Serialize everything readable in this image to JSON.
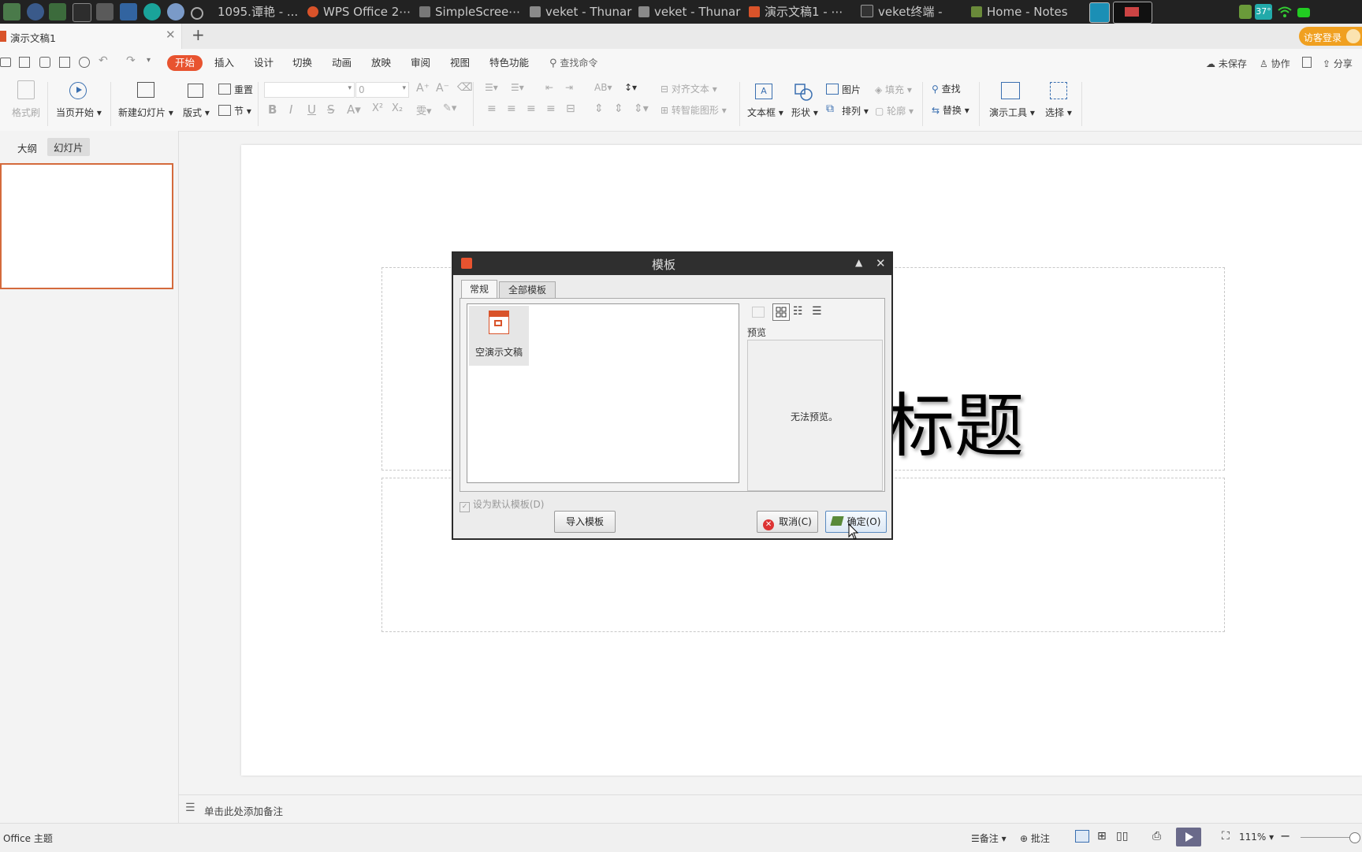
{
  "taskbar": {
    "items": [
      "1095.谭艳 - ...",
      "WPS Office 2⋯",
      "SimpleScree⋯",
      "veket - Thunar",
      "veket - Thunar",
      "演示文稿1 - ⋯",
      "veket终端 -",
      "Home - Notes"
    ],
    "tray_temp": "37°"
  },
  "doc_tab": {
    "title": "演示文稿1"
  },
  "header_right": {
    "login": "访客登录"
  },
  "menubar": {
    "tabs": [
      "开始",
      "插入",
      "设计",
      "切换",
      "动画",
      "放映",
      "审阅",
      "视图",
      "特色功能"
    ],
    "search": "查找命令",
    "unsaved": "未保存",
    "collab": "协作",
    "share": "分享"
  },
  "ribbon": {
    "format_painter": "格式刷",
    "from_current": "当页开始",
    "new_slide": "新建幻灯片",
    "layout": "版式",
    "reset": "重置",
    "section": "节",
    "font_size": "0",
    "align_text": "对齐文本",
    "smartart": "转智能图形",
    "textbox": "文本框",
    "shape": "形状",
    "picture": "图片",
    "arrange": "排列",
    "fill": "填充",
    "outline": "轮廓",
    "find": "查找",
    "replace": "替换",
    "present_tools": "演示工具",
    "select": "选择"
  },
  "leftpanel": {
    "tab_outline": "大纲",
    "tab_slides": "幻灯片"
  },
  "slide": {
    "title_partial": "加标题"
  },
  "notes": {
    "placeholder": "单击此处添加备注"
  },
  "status": {
    "theme": "Office 主题",
    "notes_btn": "备注",
    "comments_btn": "批注",
    "zoom": "111%"
  },
  "dialog": {
    "title": "模板",
    "tabs": [
      "常规",
      "全部模板"
    ],
    "template_item": "空演示文稿",
    "preview_label": "预览",
    "preview_empty": "无法预览。",
    "default_checkbox": "设为默认模板(D)",
    "import_btn": "导入模板",
    "cancel_btn": "取消(C)",
    "ok_btn": "确定(O)"
  },
  "colors": {
    "accent": "#e8532f",
    "taskbar": "#222222"
  }
}
